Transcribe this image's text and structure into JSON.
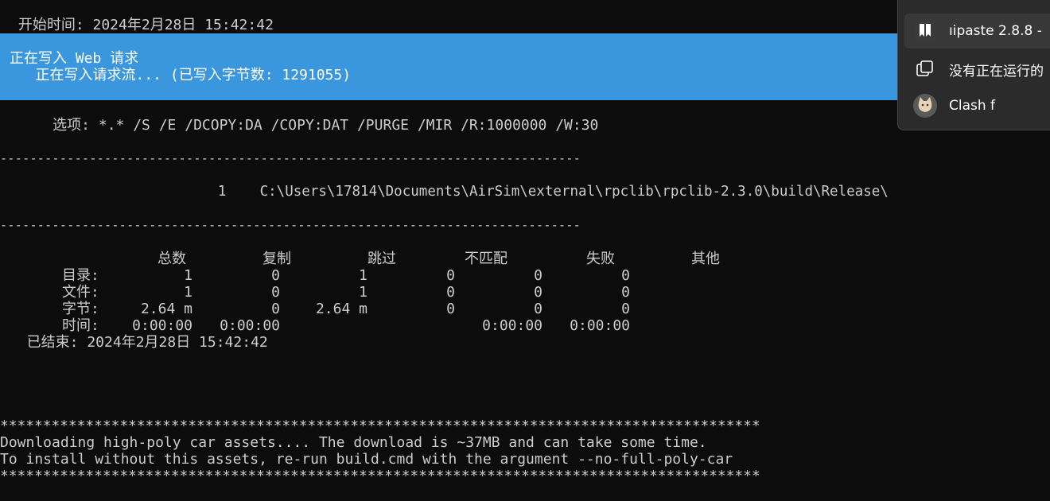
{
  "terminal": {
    "start_time": " 开始时间: 2024年2月28日 15:42:42",
    "progress": {
      "line1": "正在写入 Web 请求",
      "line2": "   正在写入请求流... (已写入字节数: 1291055)"
    },
    "options": "     选项: *.* /S /E /DCOPY:DA /COPY:DAT /PURGE /MIR /R:1000000 /W:30",
    "separator1": "------------------------------------------------------------------------------",
    "dir_entry": "                          1    C:\\Users\\17814\\Documents\\AirSim\\external\\rpclib\\rpclib-2.3.0\\build\\Release\\",
    "separator2": "------------------------------------------------------------------------------",
    "stats": {
      "headers": [
        "总数",
        "复制",
        "跳过",
        "不匹配",
        "失败",
        "其他"
      ],
      "rows": [
        {
          "label": "目录:",
          "values": [
            "1",
            "0",
            "1",
            "0",
            "0",
            "0"
          ]
        },
        {
          "label": "文件:",
          "values": [
            "1",
            "0",
            "1",
            "0",
            "0",
            "0"
          ]
        },
        {
          "label": "字节:",
          "values": [
            "2.64 m",
            "0",
            "2.64 m",
            "0",
            "0",
            "0"
          ]
        },
        {
          "label": "时间:",
          "values": [
            "0:00:00",
            "0:00:00",
            "",
            "",
            "0:00:00",
            "0:00:00"
          ]
        }
      ]
    },
    "ended": "  已结束: 2024年2月28日 15:42:42",
    "stars1": "*****************************************************************************************",
    "download_msg": "Downloading high-poly car assets.... The download is ~37MB and can take some time.",
    "install_msg": "To install without this assets, re-run build.cmd with the argument --no-full-poly-car",
    "stars2": "*****************************************************************************************"
  },
  "popup": {
    "items": [
      {
        "label": "ıipaste 2.8.8 - ",
        "icon": "snipaste-icon"
      },
      {
        "label": "没有正在运行的",
        "icon": "windows-copy-icon"
      },
      {
        "label": "Clash f",
        "icon": "cat-icon"
      }
    ]
  }
}
